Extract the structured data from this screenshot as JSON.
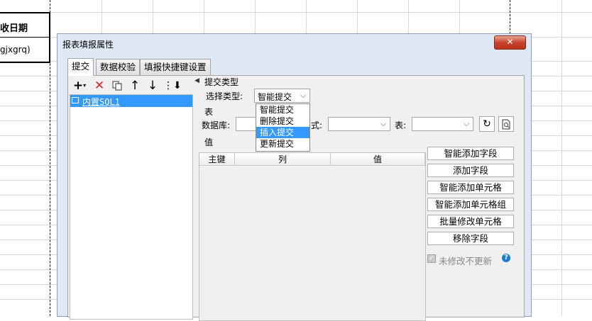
{
  "sheet": {
    "cell_header": "收日期",
    "cell_value": "gjxgrq)"
  },
  "dialog": {
    "title": "报表填报属性",
    "close_symbol": "✕",
    "tabs": [
      {
        "label": "提交",
        "active": true
      },
      {
        "label": "数据校验",
        "active": false
      },
      {
        "label": "填报快捷键设置",
        "active": false
      }
    ],
    "left_toolbar": {
      "add_icon": "plus-icon",
      "delete_icon": "delete-icon",
      "copy_icon": "copy-icon",
      "up_icon": "arrow-up-icon",
      "down_icon": "arrow-down-icon",
      "sort_icon": "sort-icon"
    },
    "submissions": [
      {
        "label": "内置SQL1",
        "selected": true
      }
    ],
    "submit_type": {
      "section_title": "提交类型",
      "label": "选择类型:",
      "value": "智能提交",
      "options": [
        "智能提交",
        "删除提交",
        "插入提交",
        "更新提交"
      ],
      "highlighted": "插入提交"
    },
    "table_section": {
      "section_title": "表",
      "database_label": "数据库:",
      "schema_label_fragment": "式:",
      "table_label": "表:"
    },
    "value_section": {
      "section_title": "值",
      "columns": [
        "主键",
        "列",
        "值"
      ]
    },
    "actions": [
      "智能添加字段",
      "添加字段",
      "智能添加单元格",
      "智能添加单元格组",
      "批量修改单元格",
      "移除字段"
    ],
    "no_update_unmodified": {
      "label": "未修改不更新",
      "checked": true,
      "disabled": true
    },
    "help_symbol": "?"
  },
  "colors": {
    "dialog_bg": "#dfe9f5",
    "selection": "#3399ff",
    "close_button": "#c7452d"
  }
}
